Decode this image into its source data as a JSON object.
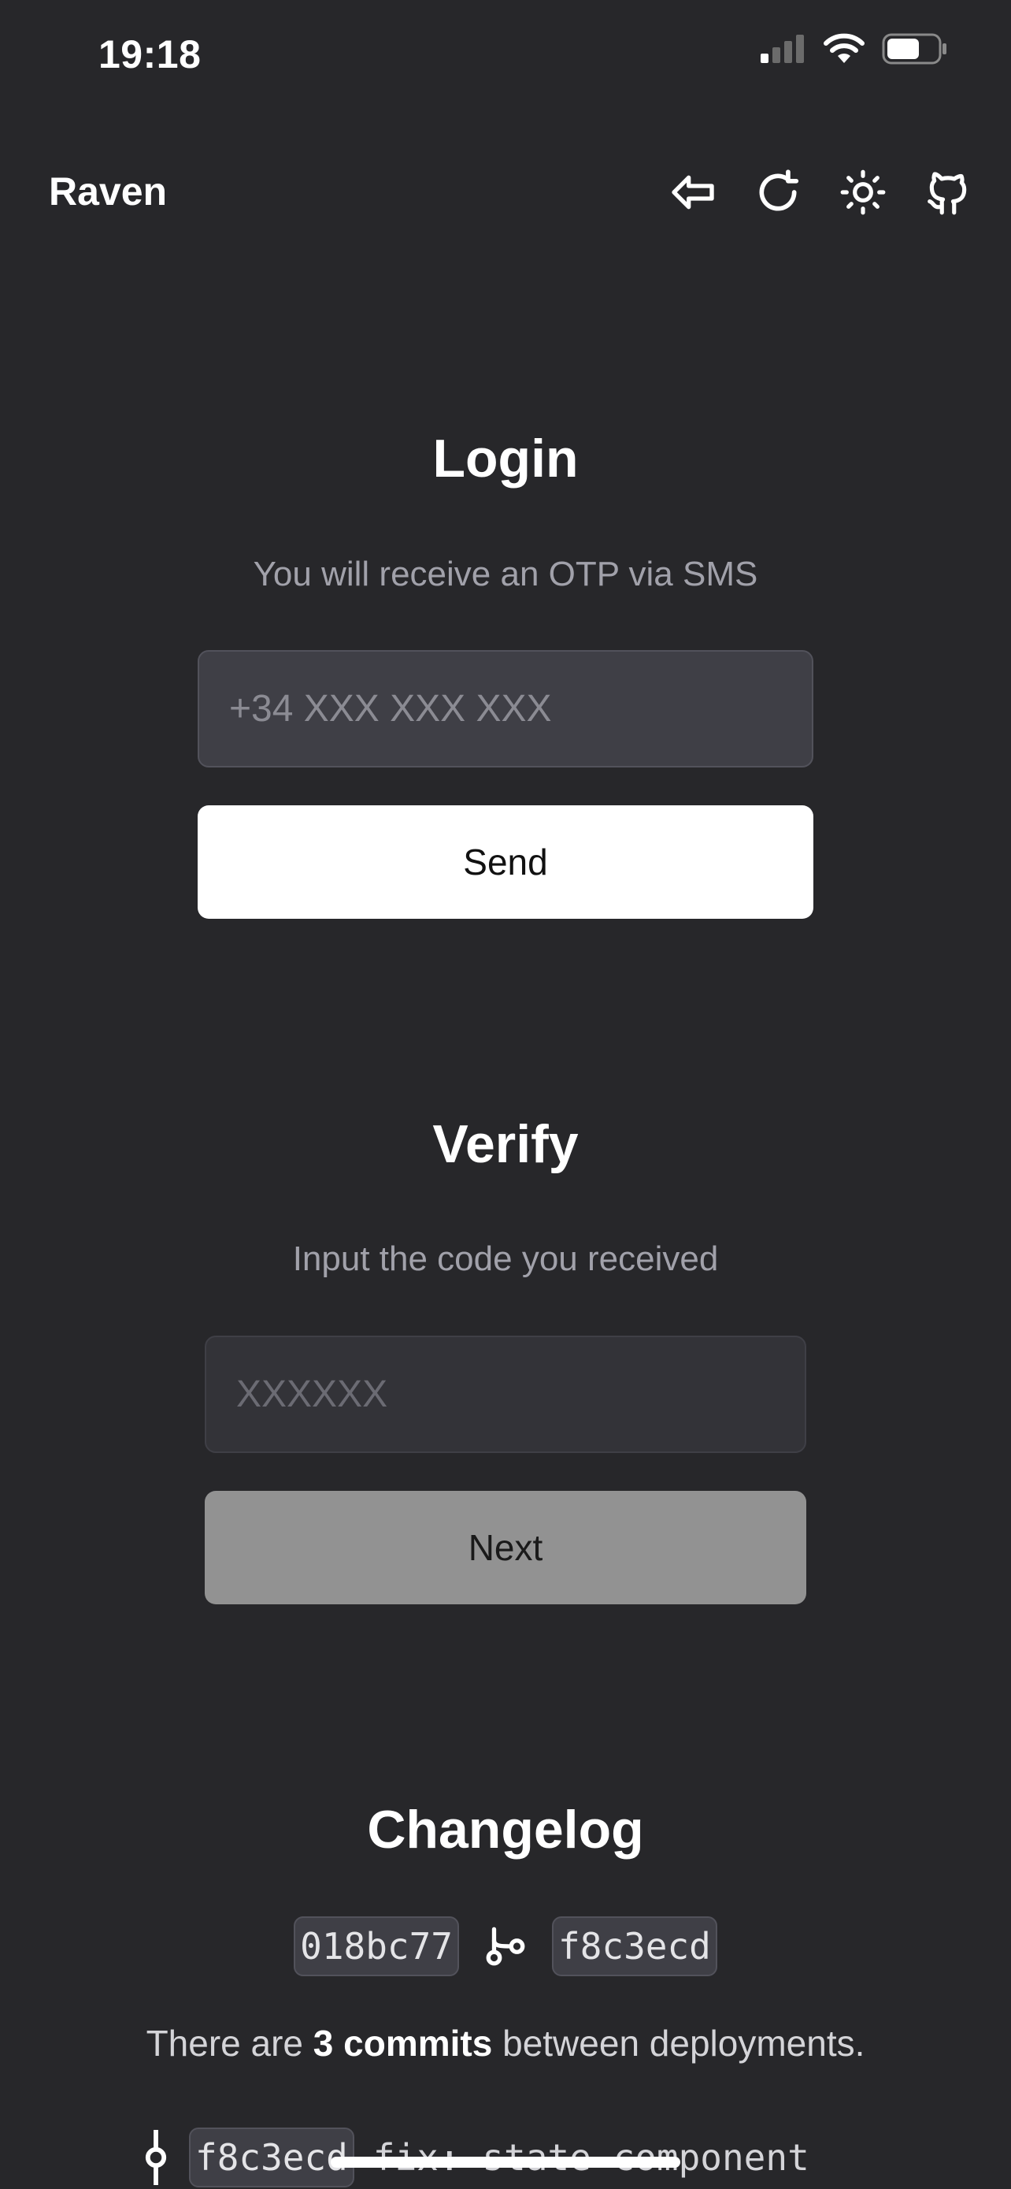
{
  "status_bar": {
    "time": "19:18"
  },
  "header": {
    "brand": "Raven"
  },
  "login": {
    "title": "Login",
    "subtitle": "You will receive an OTP via SMS",
    "phone_placeholder": "+34 XXX XXX XXX",
    "send_label": "Send"
  },
  "verify": {
    "title": "Verify",
    "subtitle": "Input the code you received",
    "code_placeholder": "XXXXXX",
    "next_label": "Next"
  },
  "changelog": {
    "title": "Changelog",
    "from_hash": "018bc77",
    "to_hash": "f8c3ecd",
    "summary_prefix": "There are",
    "summary_count": "3 commits",
    "summary_suffix": "between deployments.",
    "commits": [
      {
        "hash": "f8c3ecd",
        "message": "fix: state component"
      }
    ]
  },
  "icons": {
    "back": "arrow-left-icon",
    "reload": "refresh-icon",
    "theme": "sun-icon",
    "github": "github-icon",
    "branch": "git-branch-icon",
    "commit": "git-commit-icon"
  }
}
